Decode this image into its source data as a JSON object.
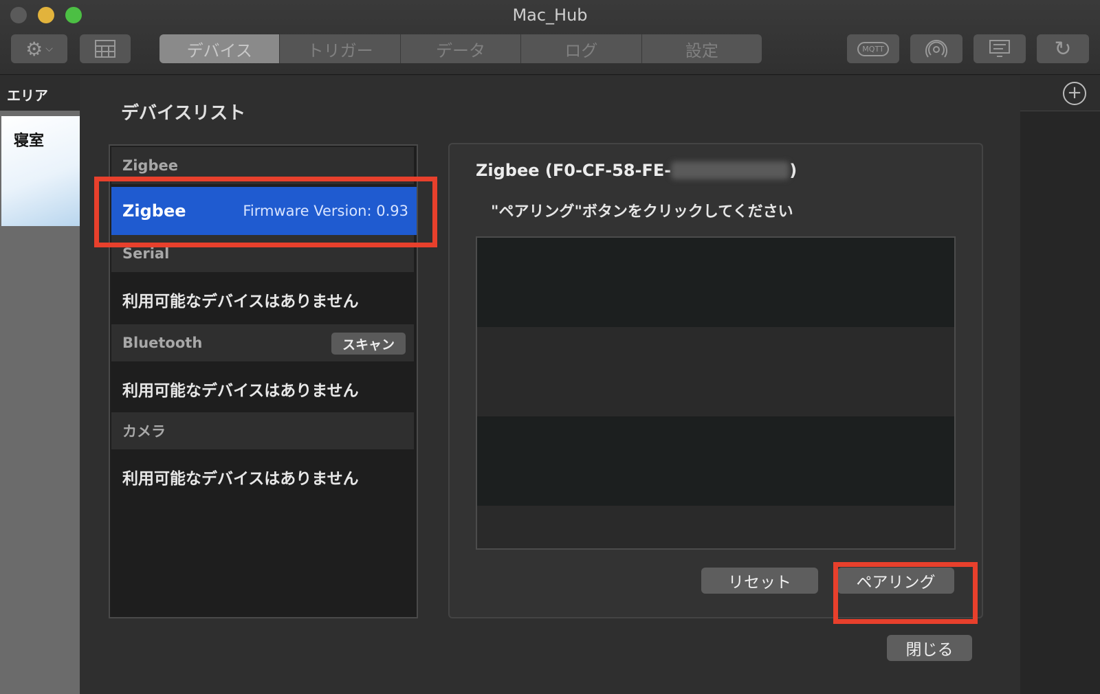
{
  "window": {
    "title": "Mac_Hub"
  },
  "toolbar": {
    "tabs": [
      {
        "label": "デバイス",
        "active": true
      },
      {
        "label": "トリガー",
        "active": false
      },
      {
        "label": "データ",
        "active": false
      },
      {
        "label": "ログ",
        "active": false
      },
      {
        "label": "設定",
        "active": false
      }
    ],
    "mqtt_label": "MQTT"
  },
  "area_sidebar": {
    "header": "エリア",
    "items": [
      {
        "label": "寝室"
      }
    ]
  },
  "sheet": {
    "title": "デバイスリスト",
    "device_list": {
      "groups": [
        {
          "header": "Zigbee",
          "selected_device": {
            "name": "Zigbee",
            "firmware": "Firmware Version: 0.93"
          }
        },
        {
          "header": "Serial",
          "empty_text": "利用可能なデバイスはありません"
        },
        {
          "header": "Bluetooth",
          "scan_label": "スキャン",
          "empty_text": "利用可能なデバイスはありません"
        },
        {
          "header": "カメラ",
          "empty_text": "利用可能なデバイスはありません"
        }
      ]
    },
    "detail": {
      "title_prefix": "Zigbee (F0-CF-58-FE-",
      "title_suffix": ")",
      "instruction": "\"ペアリング\"ボタンをクリックしてください",
      "reset_label": "リセット",
      "pair_label": "ペアリング"
    },
    "close_label": "閉じる"
  },
  "colors": {
    "selection": "#1f5bd0",
    "highlight": "#e8402c",
    "traffic_min": "#e2b33c",
    "traffic_max": "#4cbf44"
  }
}
